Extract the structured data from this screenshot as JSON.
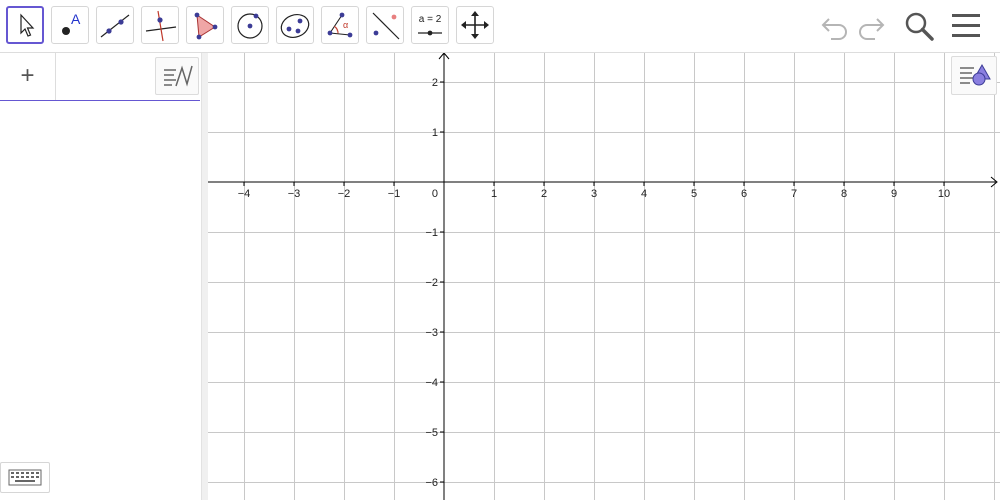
{
  "toolbar": {
    "tools": [
      {
        "name": "move"
      },
      {
        "name": "point",
        "label": "A"
      },
      {
        "name": "line"
      },
      {
        "name": "perpendicular-line"
      },
      {
        "name": "polygon"
      },
      {
        "name": "circle-with-center"
      },
      {
        "name": "ellipse"
      },
      {
        "name": "angle",
        "label": "α"
      },
      {
        "name": "reflect-about-line"
      },
      {
        "name": "slider",
        "label": "a = 2"
      },
      {
        "name": "move-graphics-view"
      }
    ],
    "right_icons": [
      "undo-icon",
      "redo-icon",
      "search-icon",
      "menu-icon"
    ]
  },
  "algebra": {
    "add_label": "+"
  },
  "graphics": {
    "axes": {
      "x_labels": [
        "−4",
        "−3",
        "−2",
        "−1",
        "0",
        "1",
        "2",
        "3",
        "4",
        "5",
        "6",
        "7",
        "8",
        "9",
        "10"
      ],
      "y_labels": [
        "2",
        "1",
        "−1",
        "−2",
        "−3",
        "−4",
        "−5",
        "−6"
      ],
      "x_range": [
        -4.75,
        11.1
      ],
      "y_range": [
        -6.3,
        2.6
      ]
    },
    "colors": {
      "grid": "#c8c8c8",
      "axis": "#000000",
      "accent": "#6557d2",
      "point": "#3c3c96",
      "polygon_fill": "#e88080"
    }
  }
}
